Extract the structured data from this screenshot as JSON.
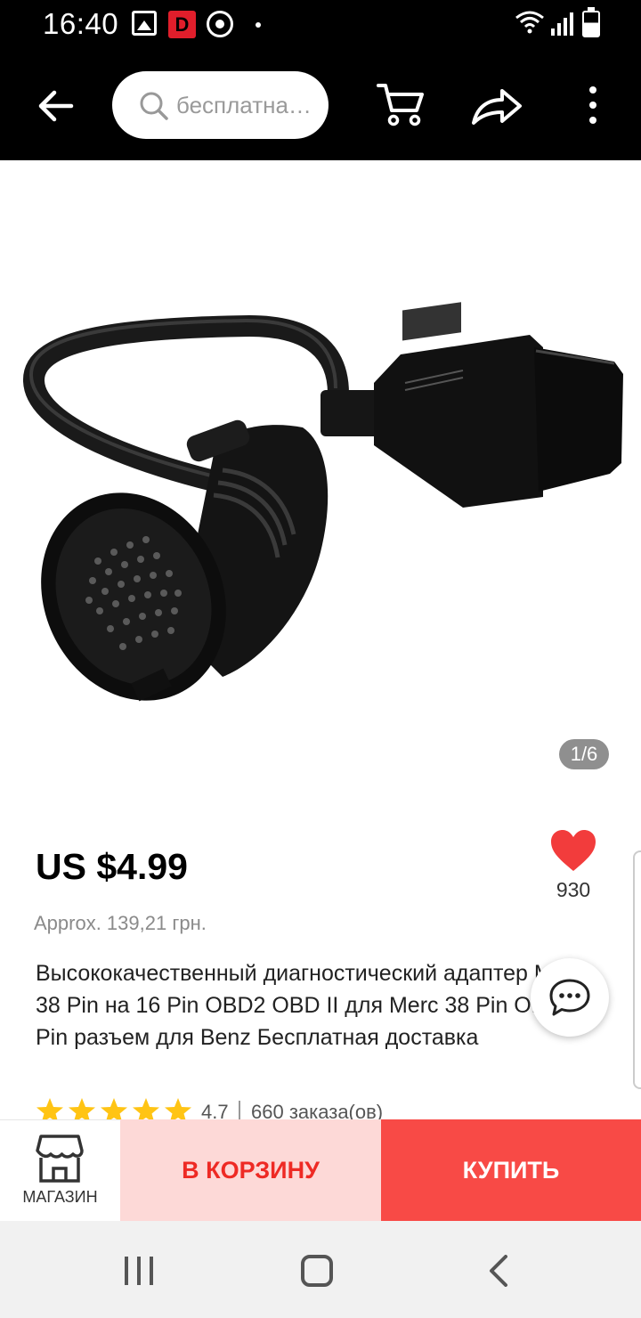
{
  "status_bar": {
    "time": "16:40",
    "icons": [
      "gallery-icon",
      "d-app-icon",
      "sync-icon",
      "notification-dot-icon",
      "wifi-icon",
      "signal-icon",
      "battery-icon"
    ],
    "d_app_letter": "D"
  },
  "top_nav": {
    "search_placeholder": "бесплатна…",
    "icons": [
      "back-arrow-icon",
      "search-icon",
      "cart-icon",
      "share-icon",
      "more-vertical-icon"
    ]
  },
  "gallery": {
    "counter": "1/6"
  },
  "product": {
    "price": "US $4.99",
    "approx_price": "Approx. 139,21 грн.",
    "wishlist_count": "930",
    "title": "Высококачественный диагностический адаптер MB с 38 Pin на 16 Pin OBD2 OBD II для Merc 38 Pin OBD 38 Pin разъем для Benz Бесплатная доставка",
    "rating": "4.7",
    "rating_stars": 5,
    "orders": "660 заказа(ов)"
  },
  "action_bar": {
    "store_label": "МАГАЗИН",
    "add_to_cart_label": "В КОРЗИНУ",
    "buy_label": "КУПИТЬ"
  },
  "colors": {
    "accent_red": "#f84a46",
    "cart_button_bg": "#fdd9d7",
    "heart": "#f23c3c",
    "star": "#ffc414"
  }
}
